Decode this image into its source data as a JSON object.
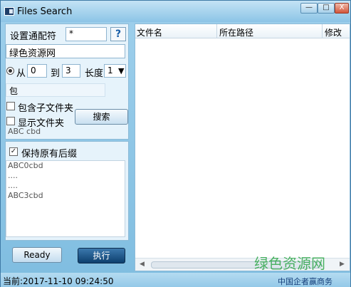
{
  "window": {
    "title": "Files Search",
    "controls": {
      "minimize": "—",
      "maximize": "□",
      "close": "X"
    }
  },
  "search_options": {
    "wildcard_label": "设置通配符",
    "wildcard_value": "*",
    "help_label": "?",
    "text_value": "绿色资源网",
    "from_label": "从",
    "from_value": "0",
    "to_label": "到",
    "to_value": "3",
    "length_label": "长度",
    "length_value": "1",
    "contains_value": "包",
    "include_subfolders_label": "包含子文件夹",
    "show_folders_label": "显示文件夹",
    "search_button": "搜索",
    "preview_ghost": "ABC cbd"
  },
  "preview": {
    "keep_suffix_label": "保持原有后缀",
    "lines": [
      "ABC0cbd",
      "....",
      "....",
      "ABC3cbd"
    ]
  },
  "actions": {
    "ready_button": "Ready",
    "execute_button": "执行"
  },
  "results": {
    "columns": [
      "文件名",
      "所在路径",
      "修改"
    ]
  },
  "status": {
    "current_time": "当前:2017-11-10 09:24:50",
    "right_text": "中国企者赢商务"
  },
  "watermark": "绿色资源网",
  "colors": {
    "accent": "#0d3f6e",
    "panel": "#e6f3fb",
    "chrome": "#8cc4e6"
  }
}
